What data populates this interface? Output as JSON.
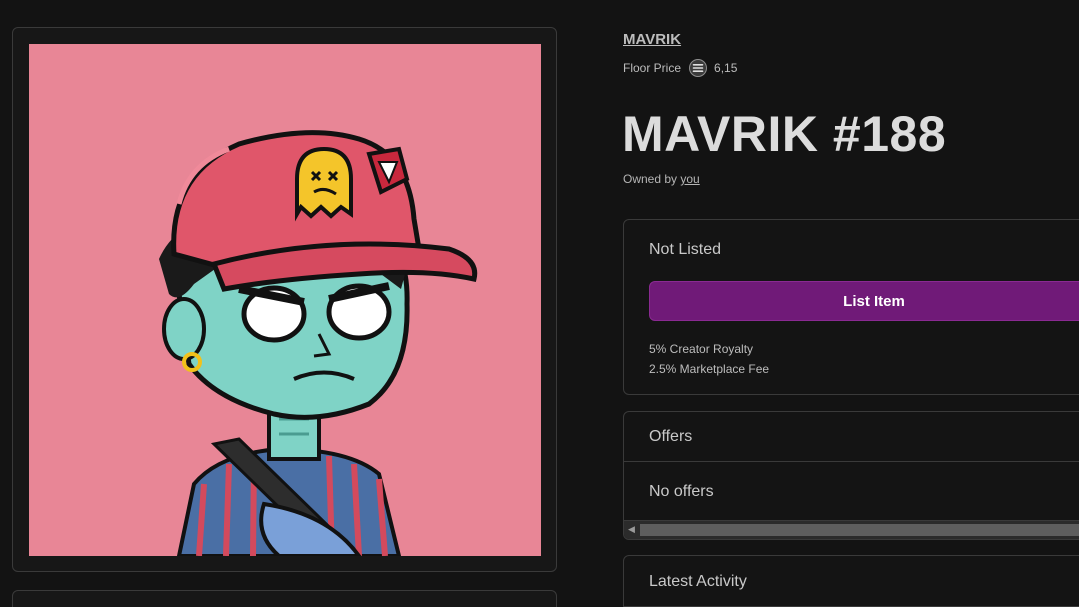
{
  "nft": {
    "collection": "MAVRIK",
    "floor_label": "Floor Price",
    "floor_value": "6,15",
    "floor_icon": "solana-icon",
    "title": "MAVRIK #188",
    "owned_by": "Owned by",
    "owner": "you",
    "image": "pfp-character-red-cap-artwork"
  },
  "listing": {
    "status": "Not Listed",
    "button": "List Item",
    "creator_royalty": "5% Creator Royalty",
    "marketplace_fee": "2.5% Marketplace Fee"
  },
  "offers": {
    "title": "Offers",
    "empty": "No offers"
  },
  "activity": {
    "title": "Latest Activity"
  },
  "colors": {
    "background": "#131313",
    "panel_border": "#3a3a3a",
    "accent_button": "#701a78",
    "art_background": "#e88696"
  }
}
